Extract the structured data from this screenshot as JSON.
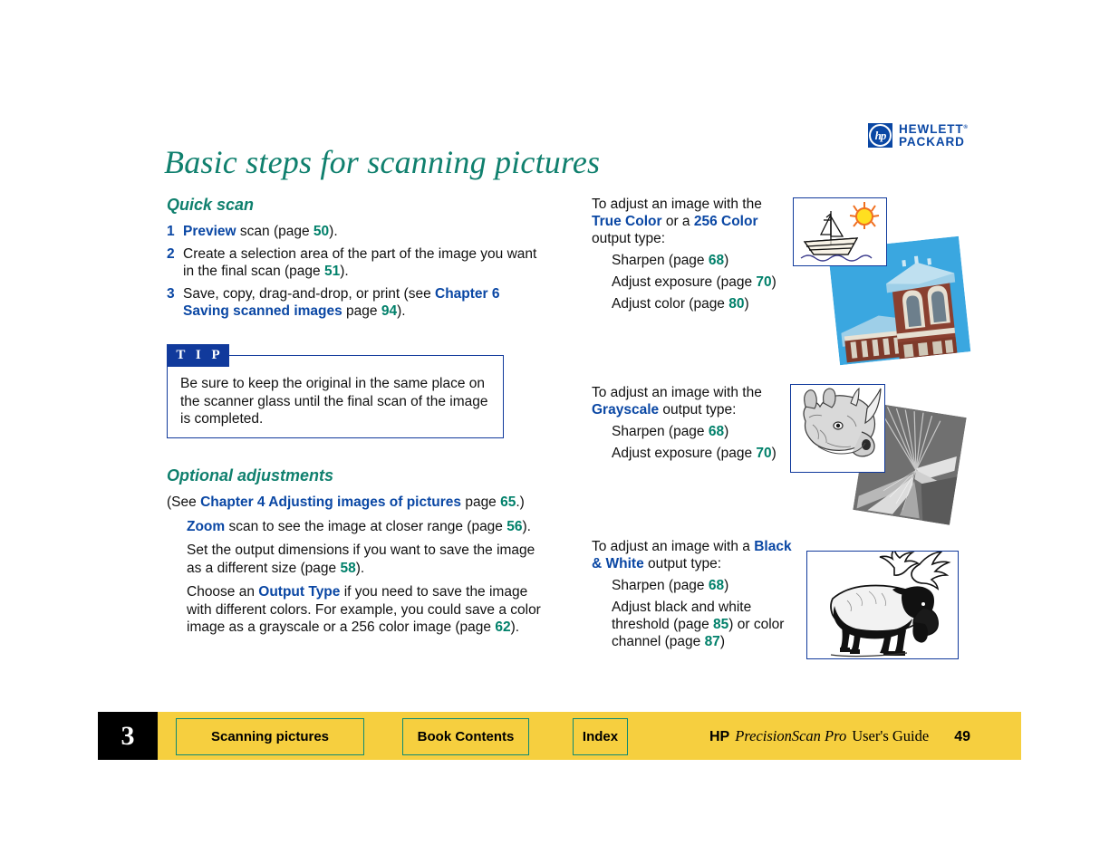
{
  "brand": {
    "logo_mark": "hp",
    "logo_line1": "HEWLETT",
    "logo_line2": "PACKARD"
  },
  "title": "Basic steps for scanning pictures",
  "left_column": {
    "quick_scan": {
      "heading": "Quick scan",
      "steps": [
        {
          "num": "1",
          "parts": [
            {
              "t": "Preview",
              "s": "blue"
            },
            {
              "t": " scan (page ",
              "s": "plain"
            },
            {
              "t": "50",
              "s": "teal"
            },
            {
              "t": ").",
              "s": "plain"
            }
          ]
        },
        {
          "num": "2",
          "parts": [
            {
              "t": "Create a selection area of the part of the image you want in the final scan (page ",
              "s": "plain"
            },
            {
              "t": "51",
              "s": "teal"
            },
            {
              "t": ").",
              "s": "plain"
            }
          ]
        },
        {
          "num": "3",
          "parts": [
            {
              "t": "Save, copy, drag-and-drop, or print (see ",
              "s": "plain"
            },
            {
              "t": "Chapter 6 Saving scanned images",
              "s": "blue"
            },
            {
              "t": " page ",
              "s": "plain"
            },
            {
              "t": "94",
              "s": "teal"
            },
            {
              "t": ").",
              "s": "plain"
            }
          ]
        }
      ]
    },
    "tip": {
      "label": "T I P",
      "text": "Be sure to keep the original in the same place on the scanner glass until the final scan of the image is completed."
    },
    "optional": {
      "heading": "Optional adjustments",
      "see_line": [
        {
          "t": "(See ",
          "s": "plain"
        },
        {
          "t": "Chapter 4 Adjusting images of pictures",
          "s": "blue"
        },
        {
          "t": " page ",
          "s": "plain"
        },
        {
          "t": "65",
          "s": "teal"
        },
        {
          "t": ".)",
          "s": "plain"
        }
      ],
      "items": [
        [
          {
            "t": "Zoom",
            "s": "blue"
          },
          {
            "t": " scan to see the image at closer range (page ",
            "s": "plain"
          },
          {
            "t": "56",
            "s": "teal"
          },
          {
            "t": ").",
            "s": "plain"
          }
        ],
        [
          {
            "t": "Set the output dimensions if you want to save the image as a different size (page ",
            "s": "plain"
          },
          {
            "t": "58",
            "s": "teal"
          },
          {
            "t": ").",
            "s": "plain"
          }
        ],
        [
          {
            "t": "Choose an ",
            "s": "plain"
          },
          {
            "t": "Output Type",
            "s": "blue"
          },
          {
            "t": " if you need to save the image with different colors. For example, you could save a color image as a grayscale or a 256 color image (page ",
            "s": "plain"
          },
          {
            "t": "62",
            "s": "teal"
          },
          {
            "t": ").",
            "s": "plain"
          }
        ]
      ]
    }
  },
  "right_column": {
    "blocks": [
      {
        "lead": [
          {
            "t": "To adjust an image with the ",
            "s": "plain"
          },
          {
            "t": "True Color",
            "s": "blue"
          },
          {
            "t": " or a ",
            "s": "plain"
          },
          {
            "t": "256 Color",
            "s": "blue"
          },
          {
            "t": " output type:",
            "s": "plain"
          }
        ],
        "bullets": [
          [
            {
              "t": "Sharpen (page ",
              "s": "plain"
            },
            {
              "t": "68",
              "s": "teal"
            },
            {
              "t": ")",
              "s": "plain"
            }
          ],
          [
            {
              "t": "Adjust exposure (page ",
              "s": "plain"
            },
            {
              "t": "70",
              "s": "teal"
            },
            {
              "t": ")",
              "s": "plain"
            }
          ],
          [
            {
              "t": "Adjust color (page ",
              "s": "plain"
            },
            {
              "t": "80",
              "s": "teal"
            },
            {
              "t": ")",
              "s": "plain"
            }
          ]
        ]
      },
      {
        "lead": [
          {
            "t": "To adjust an image with the ",
            "s": "plain"
          },
          {
            "t": "Grayscale",
            "s": "blue"
          },
          {
            "t": " output type:",
            "s": "plain"
          }
        ],
        "bullets": [
          [
            {
              "t": "Sharpen (page ",
              "s": "plain"
            },
            {
              "t": "68",
              "s": "teal"
            },
            {
              "t": ")",
              "s": "plain"
            }
          ],
          [
            {
              "t": "Adjust exposure (page ",
              "s": "plain"
            },
            {
              "t": "70",
              "s": "teal"
            },
            {
              "t": ")",
              "s": "plain"
            }
          ]
        ]
      },
      {
        "lead": [
          {
            "t": "To adjust an image with a ",
            "s": "plain"
          },
          {
            "t": "Black & White",
            "s": "blue"
          },
          {
            "t": " output type:",
            "s": "plain"
          }
        ],
        "bullets": [
          [
            {
              "t": "Sharpen (page ",
              "s": "plain"
            },
            {
              "t": "68",
              "s": "teal"
            },
            {
              "t": ")",
              "s": "plain"
            }
          ],
          [
            {
              "t": "Adjust black and white threshold (page ",
              "s": "plain"
            },
            {
              "t": "85",
              "s": "teal"
            },
            {
              "t": ") or color channel (page ",
              "s": "plain"
            },
            {
              "t": "87",
              "s": "teal"
            },
            {
              "t": ")",
              "s": "plain"
            }
          ]
        ]
      }
    ]
  },
  "artwork": [
    {
      "name": "sailboat-drawing",
      "alt": "line drawing of a sailboat with a yellow sun"
    },
    {
      "name": "building-photo",
      "alt": "color photo of a brick building against blue sky"
    },
    {
      "name": "rhino-drawing",
      "alt": "grayscale drawing of a rhinoceros head"
    },
    {
      "name": "architecture-photo",
      "alt": "grayscale photo of an architectural structure"
    },
    {
      "name": "moose-drawing",
      "alt": "black and white drawing of a moose"
    }
  ],
  "footer": {
    "chapter": "3",
    "buttons": [
      {
        "name": "scanning-pictures",
        "label": "Scanning pictures"
      },
      {
        "name": "book-contents",
        "label": "Book Contents"
      },
      {
        "name": "index",
        "label": "Index"
      }
    ],
    "id_hp": "HP",
    "id_product": "PrecisionScan Pro",
    "id_guide": "User's Guide",
    "page_number": "49"
  },
  "colors": {
    "teal": "#10806e",
    "blue": "#0a47a4",
    "tip_blue": "#113a9c",
    "footer_yellow": "#f6cf3f",
    "button_border": "#0e8a74"
  }
}
